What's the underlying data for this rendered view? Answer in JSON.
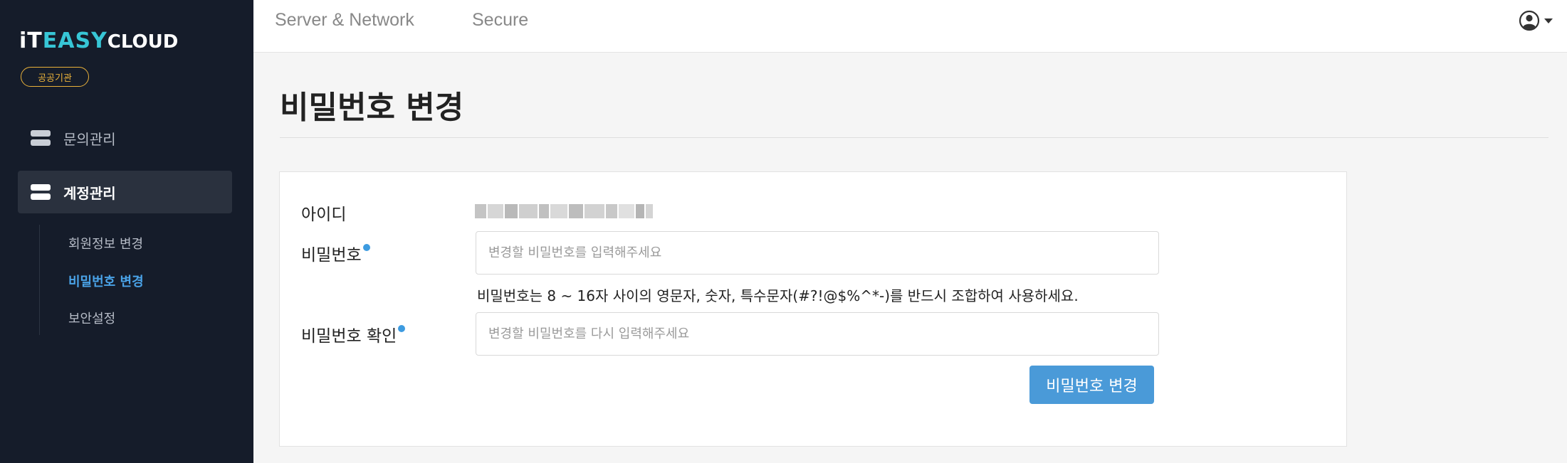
{
  "brand": {
    "logo_part1": "iT",
    "logo_part2": "EASY",
    "logo_part3": "CLOUD",
    "badge": "공공기관",
    "accent_color": "#37c6d6",
    "badge_color": "#e9b13a"
  },
  "sidebar": {
    "items": [
      {
        "label": "문의관리",
        "icon": "server-icon",
        "active": false
      },
      {
        "label": "계정관리",
        "icon": "server-icon",
        "active": true
      }
    ],
    "subitems": [
      {
        "label": "회원정보 변경",
        "active": false
      },
      {
        "label": "비밀번호 변경",
        "active": true
      },
      {
        "label": "보안설정",
        "active": false
      }
    ]
  },
  "header": {
    "tabs": [
      {
        "label": "Server & Network"
      },
      {
        "label": "Secure"
      }
    ],
    "user_icon": "user-circle-icon"
  },
  "main": {
    "title": "비밀번호 변경",
    "form": {
      "id_label": "아이디",
      "password_label": "비밀번호",
      "password_placeholder": "변경할 비밀번호를 입력해주세요",
      "hint": "비밀번호는 8 ~ 16자 사이의 영문자, 숫자, 특수문자(#?!@$%^*-)를 반드시 조합하여 사용하세요.",
      "confirm_label": "비밀번호 확인",
      "confirm_placeholder": "변경할 비밀번호를 다시 입력해주세요",
      "submit_label": "비밀번호 변경",
      "required_color": "#3d9be0",
      "button_color": "#4a9ad8"
    }
  }
}
